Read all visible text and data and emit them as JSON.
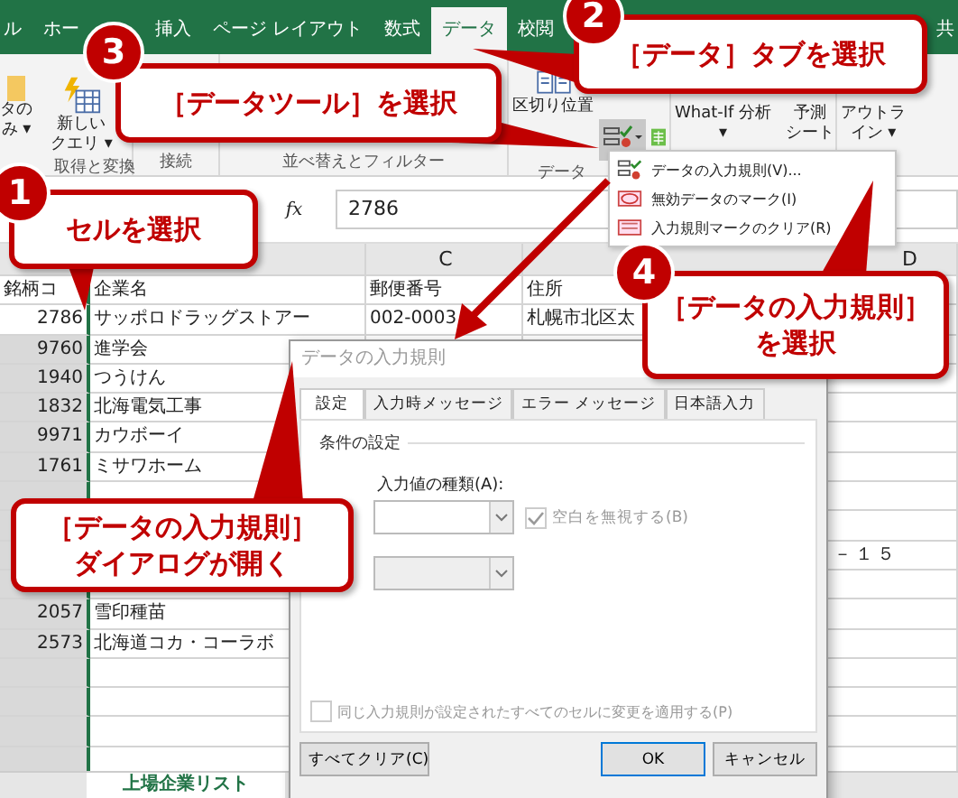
{
  "ribbon_tabs": [
    {
      "label": "ル",
      "selected": false
    },
    {
      "label": "ホー",
      "selected": false
    },
    {
      "label": "挿入",
      "selected": false
    },
    {
      "label": "ページ レイアウト",
      "selected": false
    },
    {
      "label": "数式",
      "selected": false
    },
    {
      "label": "データ",
      "selected": true
    },
    {
      "label": "校閲",
      "selected": false
    },
    {
      "label": "共",
      "selected": false
    }
  ],
  "ribbon_groups": [
    {
      "label": "取得と変換",
      "buttons": [
        {
          "kind": "partial",
          "lines": [
            "タの",
            "み ▾"
          ]
        },
        {
          "kind": "query",
          "lines": [
            "新しい",
            "クエリ ▾"
          ]
        }
      ]
    },
    {
      "label": "接続"
    },
    {
      "label": "並べ替えとフィルター"
    },
    {
      "label": "データ",
      "buttons": [
        {
          "kind": "split",
          "lines": [
            "区切り位置"
          ]
        },
        {
          "kind": "validation"
        }
      ]
    },
    {
      "buttons": [
        {
          "kind": "whatif",
          "lines": [
            "What-If 分析",
            "▾"
          ]
        },
        {
          "kind": "forecast",
          "lines": [
            "予測",
            "シート"
          ]
        }
      ]
    },
    {
      "buttons": [
        {
          "kind": "outline",
          "lines": [
            "アウトラ",
            "イン ▾"
          ]
        }
      ]
    }
  ],
  "data_tools_menu": [
    {
      "kind": "validation",
      "label": "データの入力規則(V)..."
    },
    {
      "kind": "circle",
      "label": "無効データのマーク(I)"
    },
    {
      "kind": "clear",
      "label": "入力規則マークのクリア(R)"
    }
  ],
  "formula_bar": {
    "function_symbol": "fx",
    "value": "2786"
  },
  "sheet": {
    "column_letters": [
      "C",
      "D"
    ],
    "header_row": [
      "銘柄コ",
      "企業名",
      "郵便番号",
      "住所"
    ],
    "rows": [
      {
        "code": "2786",
        "company": "サッポロドラッグストアー",
        "postal": "002-0003",
        "address": "札幌市北区太"
      },
      {
        "code": "9760",
        "company": "進学会"
      },
      {
        "code": "1940",
        "company": "つうけん"
      },
      {
        "code": "1832",
        "company": "北海電気工事"
      },
      {
        "code": "9971",
        "company": "カウボーイ"
      },
      {
        "code": "1761",
        "company": "ミサワホーム"
      },
      {},
      {},
      {
        "address_tail": "－１５"
      },
      {},
      {
        "code": "2057",
        "company": "雪印種苗"
      },
      {
        "code": "2573",
        "company": "北海道コカ・コーラボ"
      }
    ],
    "sheet_tabs": [
      {
        "label": "上場企業リスト",
        "selected": true
      }
    ]
  },
  "dialog": {
    "title": "データの入力規則",
    "tabs": [
      {
        "label": "設定",
        "selected": true
      },
      {
        "label": "入力時メッセージ",
        "selected": false
      },
      {
        "label": "エラー メッセージ",
        "selected": false
      },
      {
        "label": "日本語入力",
        "selected": false
      }
    ],
    "section": "条件の設定",
    "field_label": "入力値の種類(A):",
    "ignore_blank": {
      "label": "空白を無視する(B)",
      "checked": true,
      "disabled": true
    },
    "apply_all": {
      "label": "同じ入力規則が設定されたすべてのセルに変更を適用する(P)",
      "checked": false
    },
    "buttons": [
      {
        "label": "すべてクリア(C)",
        "default": false
      },
      {
        "label": "OK",
        "default": true
      },
      {
        "label": "キャンセル",
        "default": false
      }
    ]
  },
  "callouts": [
    {
      "number": "1",
      "lines": [
        "セルを選択"
      ]
    },
    {
      "number": "2",
      "lines": [
        "［データ］タブを選択"
      ]
    },
    {
      "number": "3",
      "lines": [
        "［データツール］を選択"
      ]
    },
    {
      "number": "4",
      "lines": [
        "［データの入力規則］",
        "を選択"
      ]
    },
    {
      "lines": [
        "［データの入力規則］",
        "ダイアログが開く"
      ]
    }
  ]
}
